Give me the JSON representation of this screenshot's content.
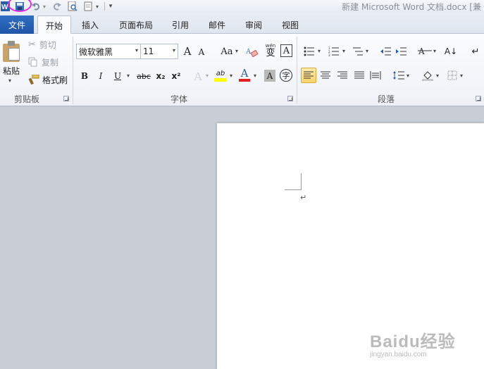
{
  "window": {
    "title": "新建 Microsoft Word 文档.docx [兼"
  },
  "quick_access": {
    "app_icon": "word-icon",
    "save_icon": "save-icon",
    "undo_icon": "undo-icon",
    "redo_icon": "redo-icon",
    "print_preview_icon": "print-preview-icon",
    "new_doc_icon": "new-document-icon",
    "customize_icon": "customize-arrow-icon"
  },
  "tabs": {
    "file": "文件",
    "items": [
      "开始",
      "插入",
      "页面布局",
      "引用",
      "邮件",
      "审阅",
      "视图"
    ],
    "active": "开始"
  },
  "clipboard": {
    "paste": "粘贴",
    "cut": "剪切",
    "copy": "复制",
    "format_painter": "格式刷",
    "group_label": "剪贴板"
  },
  "font": {
    "name": "微软雅黑",
    "size": "11",
    "grow": "A",
    "shrink": "A",
    "change_case": "Aa",
    "phonetic_label": "wén",
    "phonetic_char": "变",
    "border_char": "A",
    "bold": "B",
    "italic": "I",
    "underline": "U",
    "strike": "abc",
    "subscript": "x₂",
    "superscript": "x²",
    "text_effect": "A",
    "highlight": "ab",
    "font_color": "A",
    "char_shading": "A",
    "enclose": "字",
    "group_label": "字体",
    "highlight_color": "#ffff00",
    "font_color_value": "#e02020"
  },
  "paragraph": {
    "group_label": "段落"
  },
  "document": {
    "paragraph_mark": "↵"
  },
  "watermark": {
    "main": "Baidu经验",
    "sub": "jingyan.baidu.com"
  }
}
